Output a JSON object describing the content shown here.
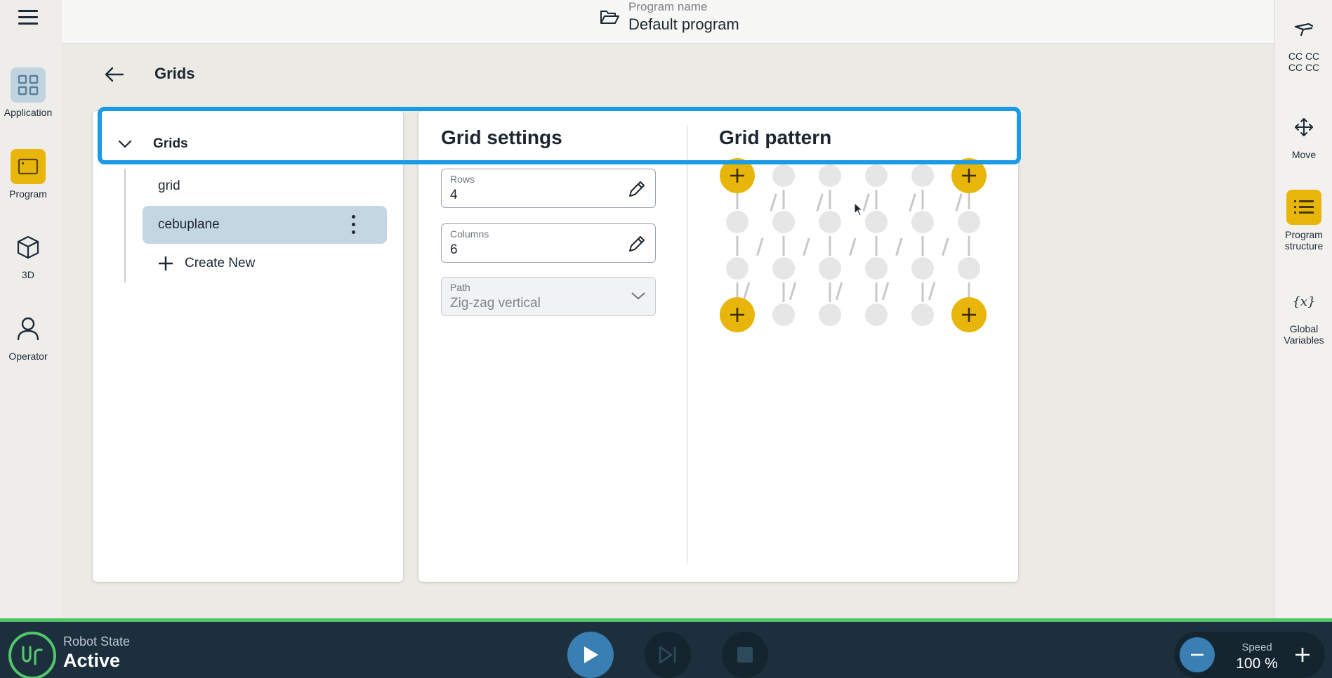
{
  "sidebar": {
    "items": [
      {
        "label": "Application",
        "icon": "grid-icon"
      },
      {
        "label": "Program",
        "icon": "program-icon"
      },
      {
        "label": "3D",
        "icon": "cube-icon"
      },
      {
        "label": "Operator",
        "icon": "user-icon"
      }
    ]
  },
  "topbar": {
    "program_label": "Program name",
    "program_name": "Default program"
  },
  "right_sidebar": {
    "tcp_line1": "CC CC",
    "tcp_line2": "CC CC",
    "move": "Move",
    "structure_line1": "Program",
    "structure_line2": "structure",
    "variables_line1": "Global",
    "variables_line2": "Variables",
    "variables_glyph": "{x}"
  },
  "page": {
    "title": "Grids"
  },
  "tree": {
    "header": "Grids",
    "items": [
      "grid",
      "cebuplane"
    ],
    "create_new": "Create New"
  },
  "settings": {
    "title": "Grid settings",
    "rows_label": "Rows",
    "rows_value": "4",
    "columns_label": "Columns",
    "columns_value": "6",
    "path_label": "Path",
    "path_value": "Zig-zag vertical"
  },
  "pattern": {
    "title": "Grid pattern",
    "rows": 4,
    "columns": 6
  },
  "status": {
    "robot_state_label": "Robot State",
    "robot_state_value": "Active",
    "speed_label": "Speed",
    "speed_value": "100 %"
  },
  "colors": {
    "accent_yellow": "#e8b60a",
    "highlight_blue": "#1a9be6",
    "active_green": "#53c66c",
    "bottom_bar": "#1c2f3c"
  }
}
